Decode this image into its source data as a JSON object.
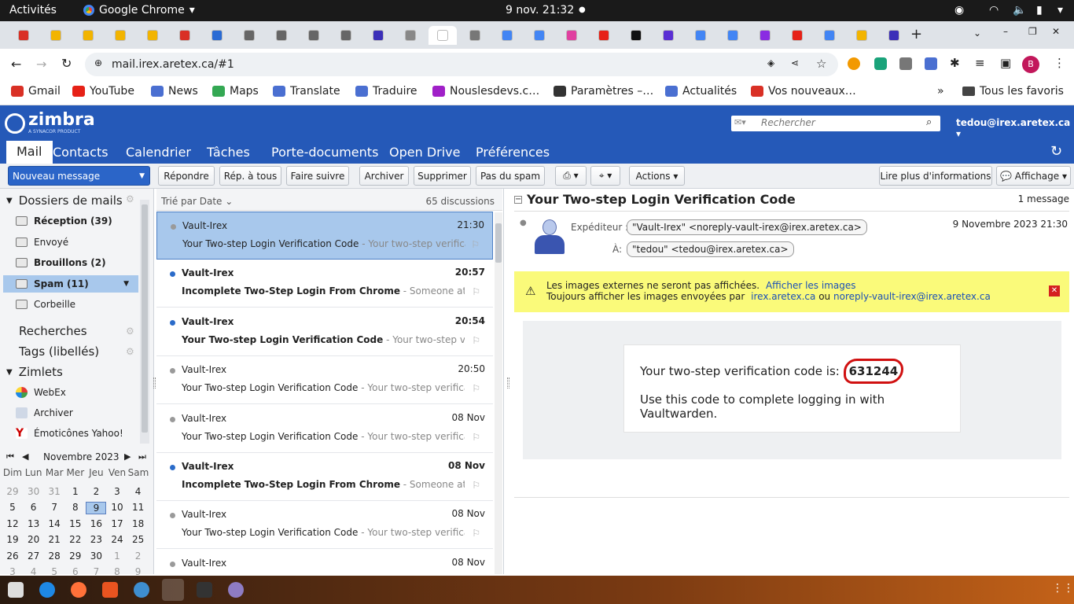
{
  "os_bar": {
    "activities": "Activités",
    "app": "Google Chrome",
    "clock": "9 nov.  21:32"
  },
  "browser": {
    "url": "mail.irex.aretex.ca/#1",
    "bookmarks": [
      {
        "label": "Gmail",
        "icon": "gmail-icon",
        "color": "#d93025"
      },
      {
        "label": "YouTube",
        "icon": "youtube-icon",
        "color": "#e62117"
      },
      {
        "label": "News",
        "icon": "news-icon",
        "color": "#4a6fd1"
      },
      {
        "label": "Maps",
        "icon": "maps-icon",
        "color": "#34a853"
      },
      {
        "label": "Translate",
        "icon": "translate-icon",
        "color": "#4a6fd1"
      },
      {
        "label": "Traduire",
        "icon": "translate-icon",
        "color": "#4a6fd1"
      },
      {
        "label": "Nouslesdevs.c…",
        "icon": "nouslesdevs-icon",
        "color": "#a020c8"
      },
      {
        "label": "Paramètres –…",
        "icon": "gear-icon",
        "color": "#333"
      },
      {
        "label": "Actualités",
        "icon": "news-icon",
        "color": "#4a6fd1"
      },
      {
        "label": "Vos nouveaux…",
        "icon": "gmail-icon",
        "color": "#d93025"
      }
    ],
    "all_bookmarks": "Tous les favoris"
  },
  "zimbra": {
    "logo": "zimbra",
    "logo_sub": "A SYNACOR PRODUCT",
    "search_placeholder": "Rechercher",
    "user": "tedou@irex.aretex.ca",
    "tabs": [
      "Mail",
      "Contacts",
      "Calendrier",
      "Tâches",
      "Porte-documents",
      "Open Drive",
      "Préférences"
    ]
  },
  "toolbar": {
    "new_message": "Nouveau message",
    "reply": "Répondre",
    "reply_all": "Rép. à tous",
    "forward": "Faire suivre",
    "archive": "Archiver",
    "delete": "Supprimer",
    "not_spam": "Pas du spam",
    "actions": "Actions",
    "read_more": "Lire plus d'informations",
    "view": "Affichage"
  },
  "sidebar": {
    "folders_title": "Dossiers de mails",
    "folders": [
      {
        "label": "Réception (39)",
        "bold": true
      },
      {
        "label": "Envoyé",
        "bold": false
      },
      {
        "label": "Brouillons (2)",
        "bold": true
      },
      {
        "label": "Spam (11)",
        "bold": true
      },
      {
        "label": "Corbeille",
        "bold": false
      }
    ],
    "searches": "Recherches",
    "tags": "Tags (libellés)",
    "zimlets_title": "Zimlets",
    "zimlets": [
      "WebEx",
      "Archiver",
      "Émoticônes Yahoo!"
    ]
  },
  "calendar": {
    "month": "Novembre 2023",
    "weekdays": [
      "Dim",
      "Lun",
      "Mar",
      "Mer",
      "Jeu",
      "Ven",
      "Sam"
    ],
    "days": [
      [
        "29",
        "30",
        "31",
        "1",
        "2",
        "3",
        "4"
      ],
      [
        "5",
        "6",
        "7",
        "8",
        "9",
        "10",
        "11"
      ],
      [
        "12",
        "13",
        "14",
        "15",
        "16",
        "17",
        "18"
      ],
      [
        "19",
        "20",
        "21",
        "22",
        "23",
        "24",
        "25"
      ],
      [
        "26",
        "27",
        "28",
        "29",
        "30",
        "1",
        "2"
      ],
      [
        "3",
        "4",
        "5",
        "6",
        "7",
        "8",
        "9"
      ]
    ],
    "today": "9"
  },
  "list": {
    "sort": "Trié par Date",
    "count": "65 discussions",
    "rows": [
      {
        "from": "Vault-Irex",
        "time": "21:30",
        "subject": "Your Two-step Login Verification Code",
        "fragment": " - Your two-step verification co",
        "unread": false,
        "selected": true
      },
      {
        "from": "Vault-Irex",
        "time": "20:57",
        "subject": "Incomplete Two-Step Login From Chrome",
        "fragment": " - Someone attempted",
        "unread": true,
        "selected": false
      },
      {
        "from": "Vault-Irex",
        "time": "20:54",
        "subject": "Your Two-step Login Verification Code",
        "fragment": " - Your two-step verificatior",
        "unread": true,
        "selected": false
      },
      {
        "from": "Vault-Irex",
        "time": "20:50",
        "subject": "Your Two-step Login Verification Code",
        "fragment": " - Your two-step verification co",
        "unread": false,
        "selected": false
      },
      {
        "from": "Vault-Irex",
        "time": "08 Nov",
        "subject": "Your Two-step Login Verification Code",
        "fragment": " - Your two-step verification co",
        "unread": false,
        "selected": false
      },
      {
        "from": "Vault-Irex",
        "time": "08 Nov",
        "subject": "Incomplete Two-Step Login From Chrome",
        "fragment": " - Someone attempted",
        "unread": true,
        "selected": false
      },
      {
        "from": "Vault-Irex",
        "time": "08 Nov",
        "subject": "Your Two-step Login Verification Code",
        "fragment": " - Your two-step verification co",
        "unread": false,
        "selected": false
      },
      {
        "from": "Vault-Irex",
        "time": "08 Nov",
        "subject": "",
        "fragment": "",
        "unread": false,
        "selected": false
      }
    ]
  },
  "reader": {
    "title": "Your Two-step Login Verification Code",
    "count": "1 message",
    "from_label": "Expéditeur :",
    "from": "\"Vault-Irex\" <noreply-vault-irex@irex.aretex.ca>",
    "to_label": "À:",
    "to": "\"tedou\" <tedou@irex.aretex.ca>",
    "date": "9 Novembre 2023 21:30",
    "warn1": "Les images externes ne seront pas affichées.",
    "warn_link": "Afficher les images",
    "warn2": "Toujours afficher les images envoyées par",
    "warn_domain": "irex.aretex.ca",
    "warn_or": "ou",
    "warn_addr": "noreply-vault-irex@irex.aretex.ca",
    "body1": "Your two-step verification code is: ",
    "code": "631244",
    "body2": "Use this code to complete logging in with Vaultwarden."
  },
  "colors": {
    "zimbra_blue": "#2559b8",
    "selected_row": "#a8c8ec",
    "warning": "#fafa7a",
    "unread_dot": "#2a6bc9"
  }
}
